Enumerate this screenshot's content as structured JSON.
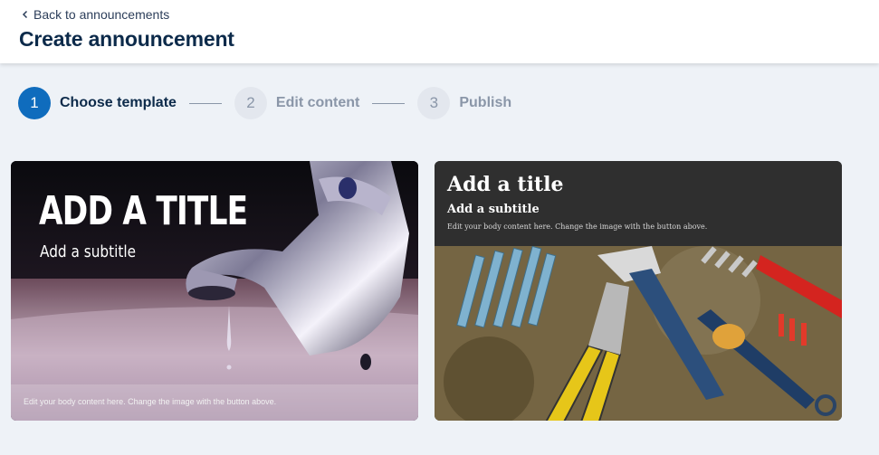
{
  "header": {
    "back_label": "Back to announcements",
    "title": "Create announcement"
  },
  "stepper": {
    "steps": [
      {
        "number": "1",
        "label": "Choose template",
        "state": "active"
      },
      {
        "number": "2",
        "label": "Edit content",
        "state": "inactive"
      },
      {
        "number": "3",
        "label": "Publish",
        "state": "inactive"
      }
    ]
  },
  "templates": [
    {
      "title": "ADD A TITLE",
      "subtitle": "Add a subtitle",
      "body": "Edit your body content here. Change the image with the button above.",
      "image": "faucet-photo"
    },
    {
      "title": "Add a title",
      "subtitle": "Add a subtitle",
      "body": "Edit your body content here. Change the image with the button above.",
      "image": "tools-photo"
    }
  ],
  "colors": {
    "accent": "#0f6cbd",
    "page_bg": "#eef2f7",
    "title": "#0c2a4a"
  }
}
